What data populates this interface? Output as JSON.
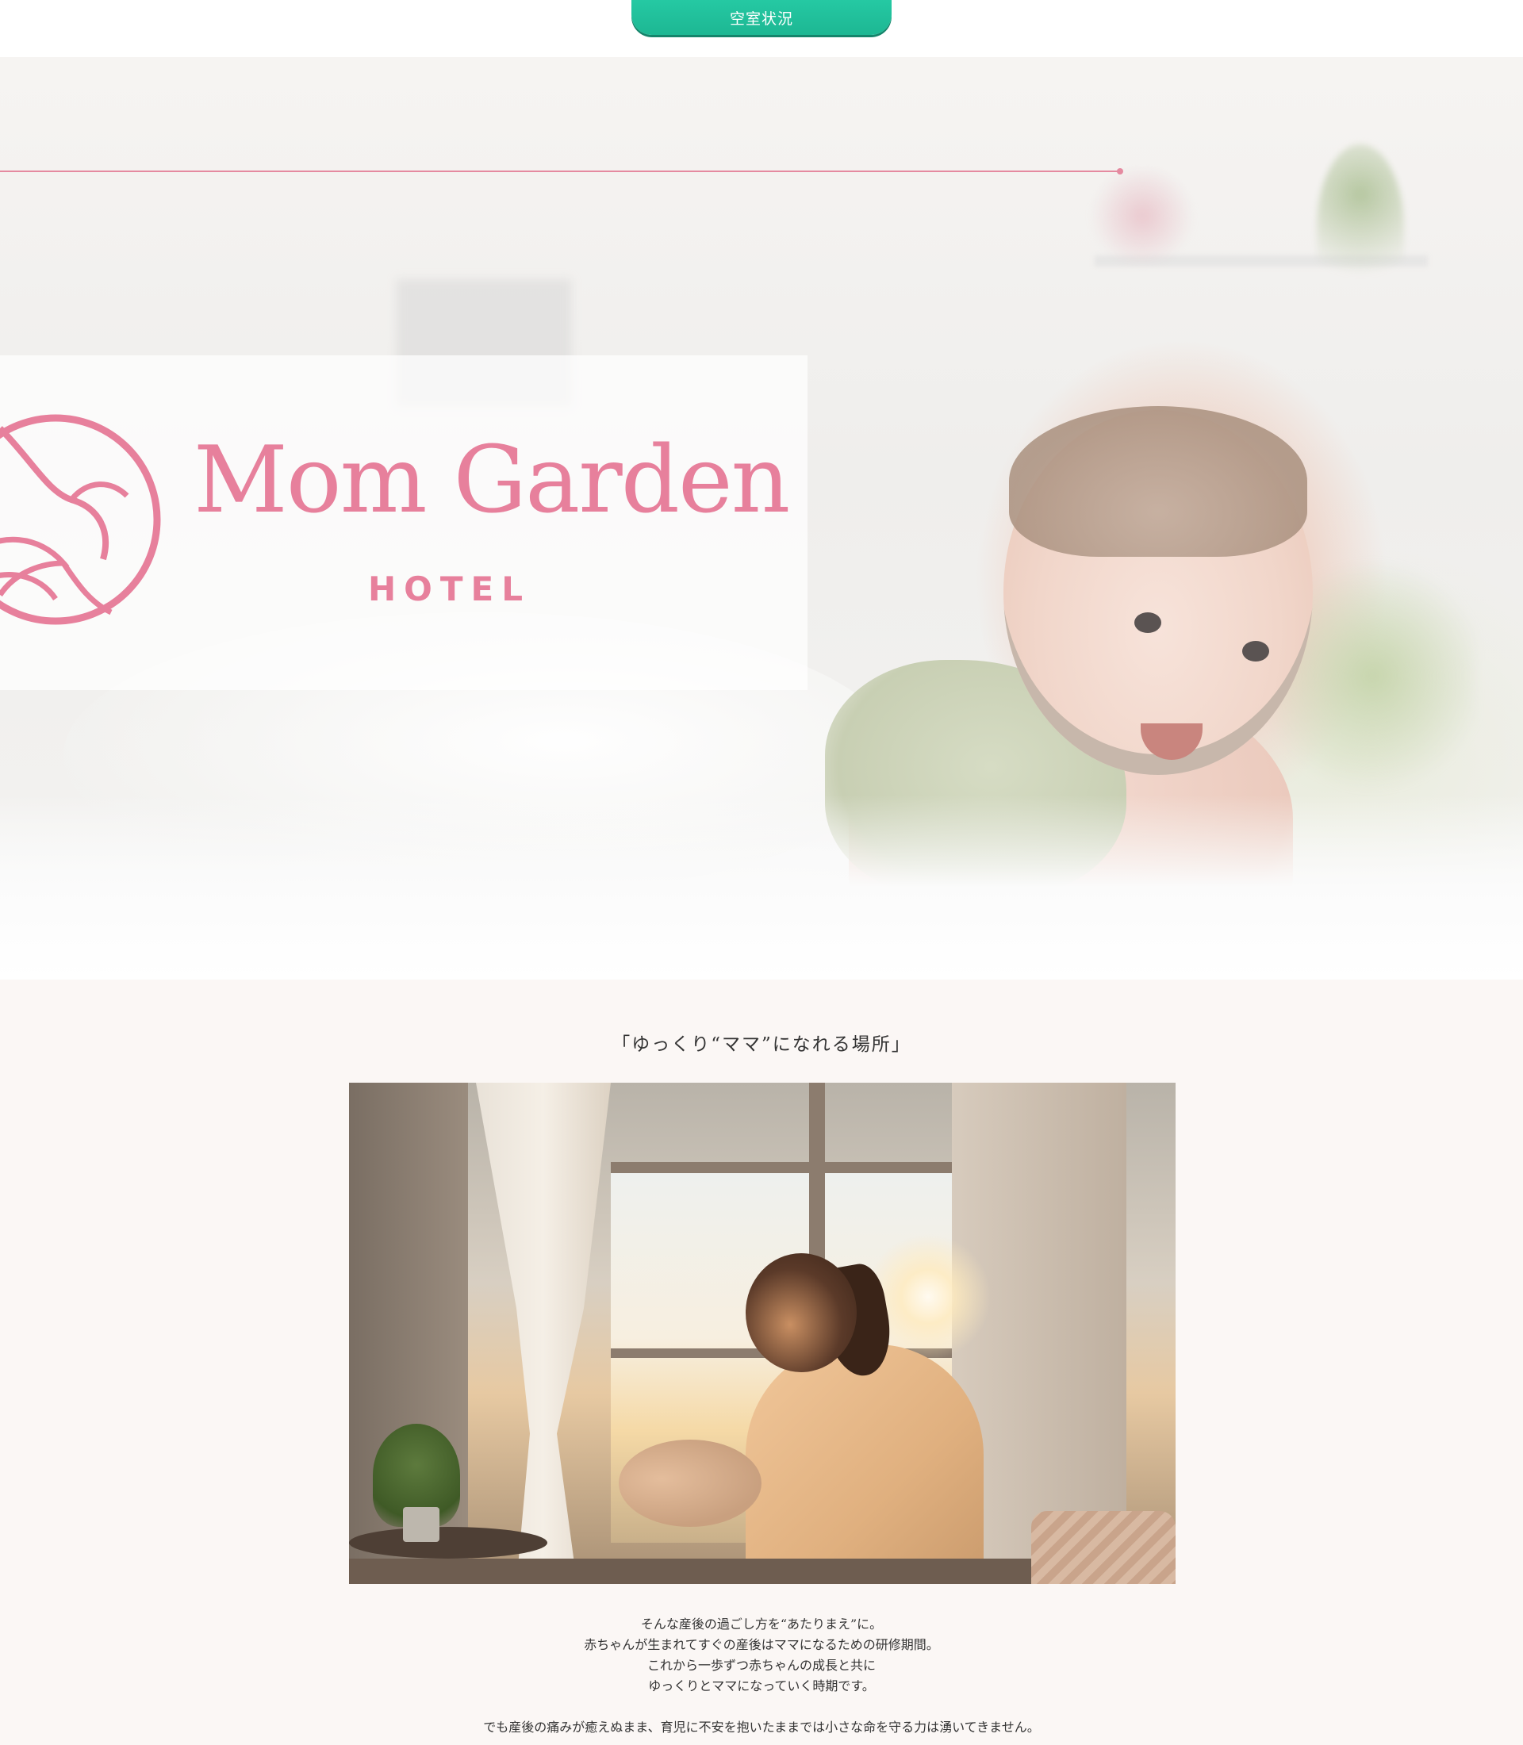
{
  "header": {
    "vacancy_button_label": "空室状況"
  },
  "hero": {
    "logo_title": "Mom Garden",
    "logo_subtitle": "HOTEL",
    "colors": {
      "brand_pink": "#e7809c",
      "line_pink": "#e58aa0"
    }
  },
  "intro": {
    "heading": "「ゆっくり“ママ”になれる場所」",
    "lines": [
      "そんな産後の過ごし方を“あたりまえ”に。",
      "赤ちゃんが生まれてすぐの産後はママになるための研修期間。",
      "これから一歩ずつ赤ちゃんの成長と共に",
      "ゆっくりとママになっていく時期です。",
      "",
      "でも産後の痛みが癒えぬまま、育児に不安を抱いたままでは小さな命を守る力は湧いてきません。"
    ]
  },
  "colors": {
    "accent_green": "#1fbe98",
    "section_bg": "#fbf7f5"
  }
}
